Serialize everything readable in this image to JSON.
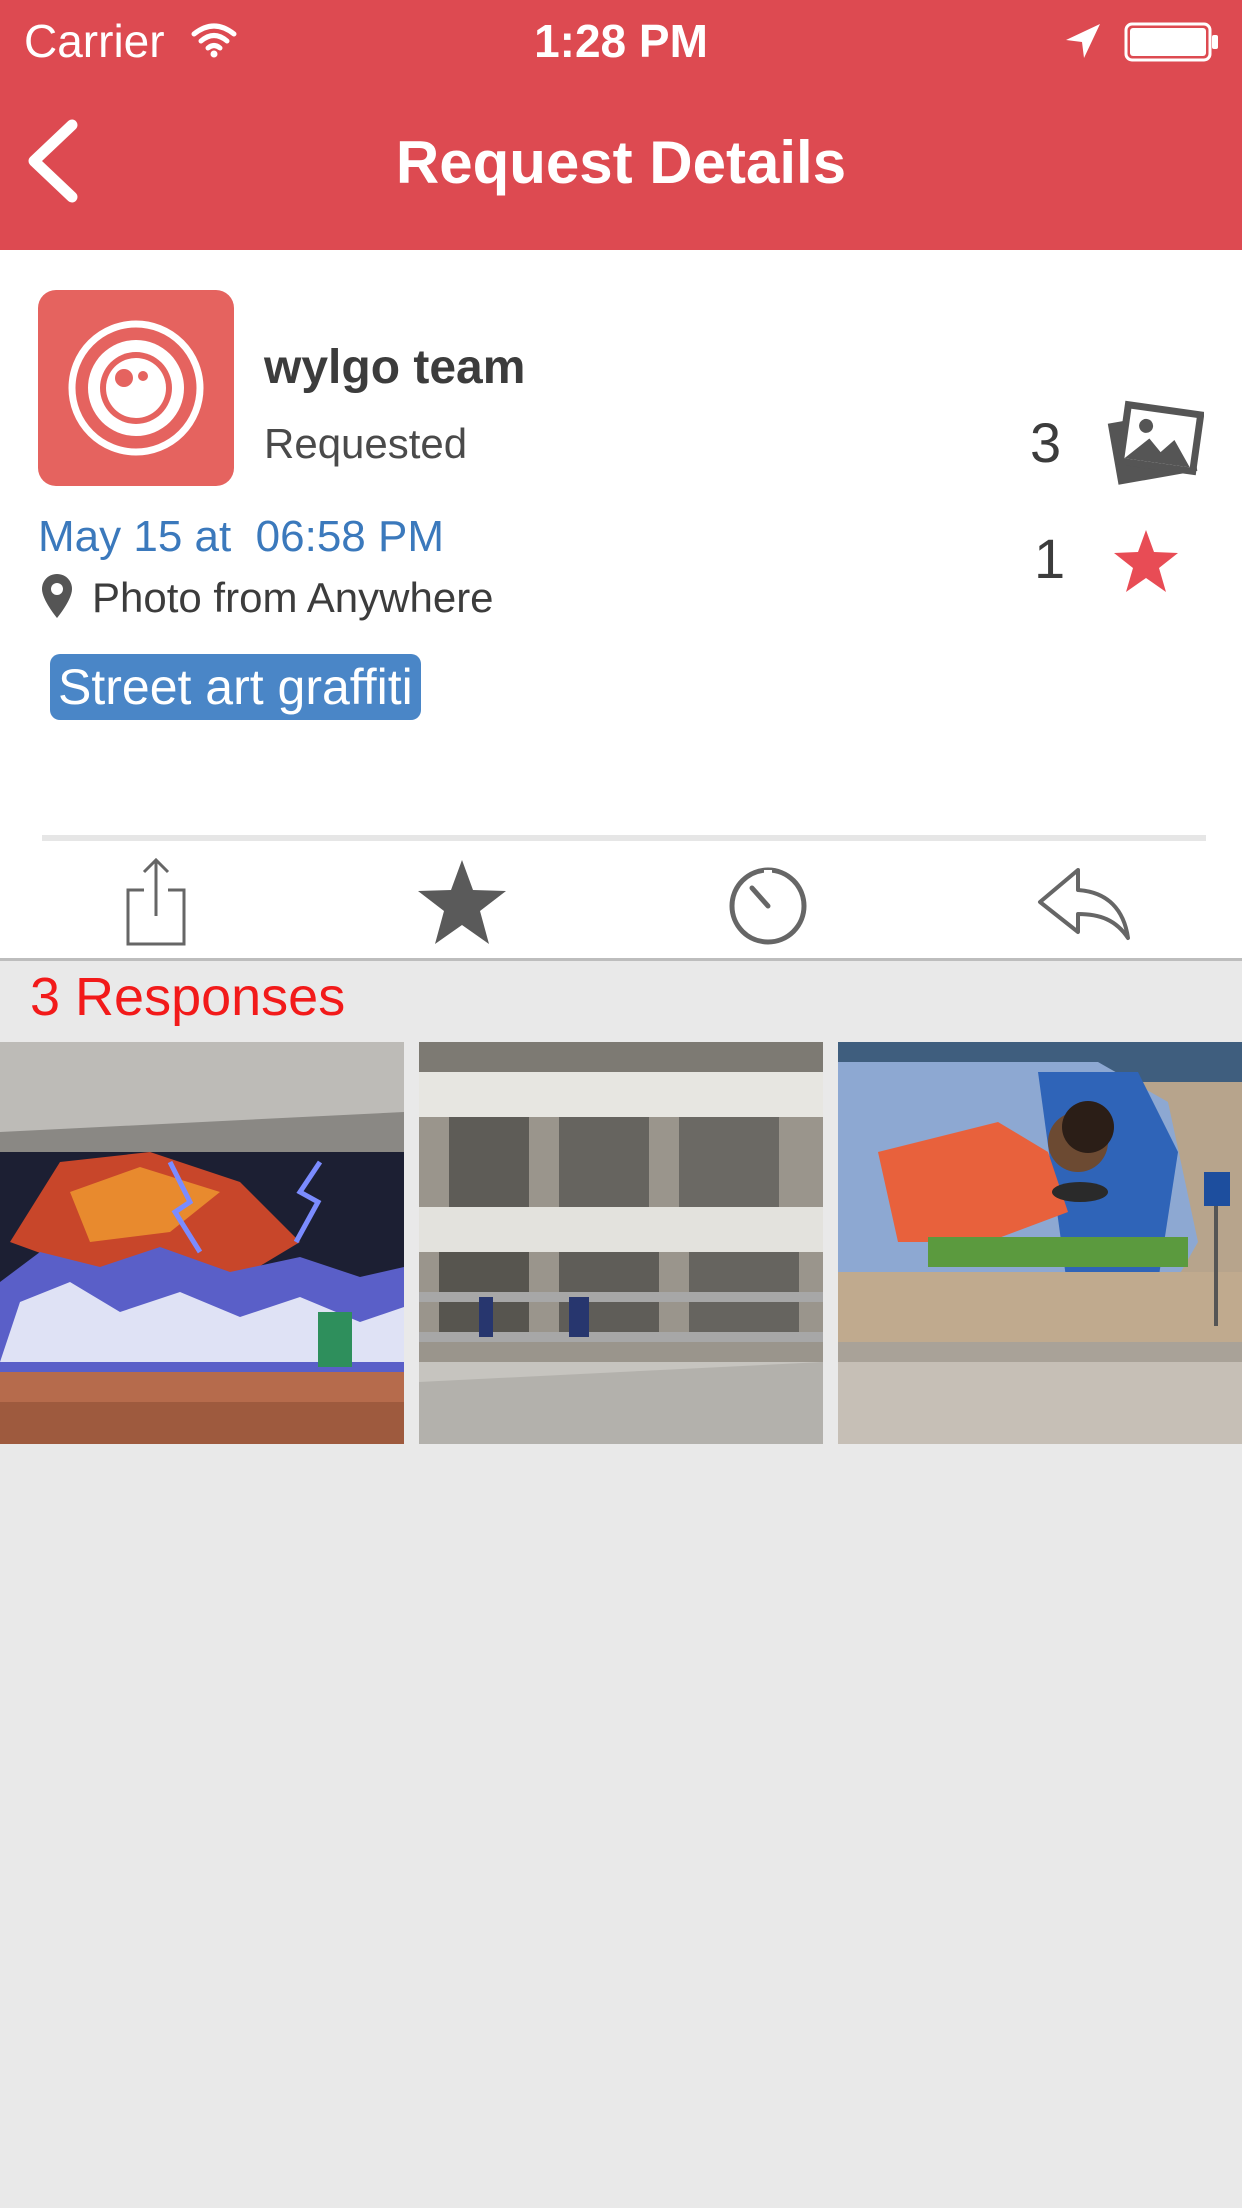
{
  "status_bar": {
    "carrier": "Carrier",
    "time": "1:28 PM"
  },
  "nav": {
    "title": "Request Details",
    "back_icon": "chevron-left-icon"
  },
  "request": {
    "user_name": "wylgo team",
    "status": "Requested",
    "date": "May 15 at  06:58 PM",
    "location": "Photo from Anywhere",
    "tag": "Street art graffiti",
    "photo_count": "3",
    "star_count": "1"
  },
  "actions": [
    {
      "icon": "share-icon"
    },
    {
      "icon": "star-icon"
    },
    {
      "icon": "timer-icon"
    },
    {
      "icon": "reply-icon"
    }
  ],
  "responses": {
    "title": "3 Responses",
    "photos": [
      "graffiti-phoenix-photo",
      "building-graffiti-photo",
      "mural-magnifier-photo"
    ]
  },
  "colors": {
    "header": "#dd4a51",
    "avatar": "#e5635f",
    "date": "#3b79bc",
    "tag": "#4a86c7",
    "responses_title": "#f21a1a",
    "star": "#e84c55"
  }
}
